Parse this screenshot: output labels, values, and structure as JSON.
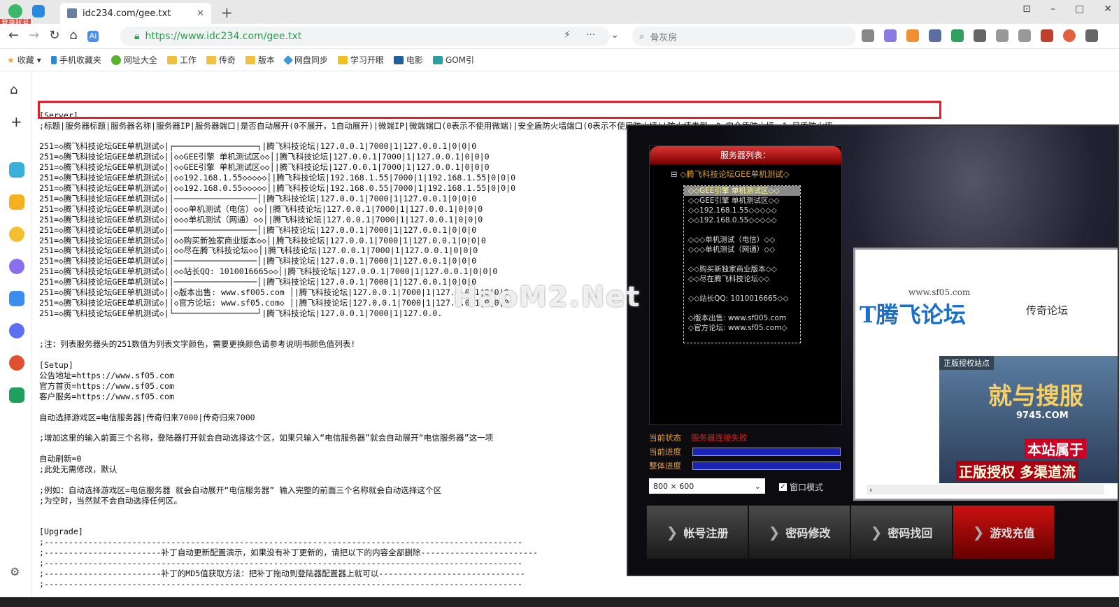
{
  "browser": {
    "tab_title": "idc234.com/gee.txt",
    "badge": "登录账号",
    "url": "https://www.idc234.com/gee.txt",
    "search_placeholder": "骨灰房",
    "bookmarks": [
      "收藏",
      "手机收藏夹",
      "网址大全",
      "工作",
      "传奇",
      "版本",
      "网盘同步",
      "学习开眼",
      "电影",
      "GOM引"
    ]
  },
  "file": {
    "lines": [
      "[Server]",
      ";标题|服务器标题|服务器名称|服务器IP|服务器端口|是否自动展开(0不展开，1自动展开)|微端IP|微端端口(0表示不使用微端)|安全盾防火墙端口(0表示不使用防火墙)|防火墙类型，0=安全盾防火墙，1=风盾防火墙",
      "",
      "251=◇腾飞科技论坛GEE单机测试◇|┌─────────────────┐|腾飞科技论坛|127.0.0.1|7000|1|127.0.0.1|0|0|0",
      "251=◇腾飞科技论坛GEE单机测试◇|│◇◇GEE引擎 单机测试区◇◇│|腾飞科技论坛|127.0.0.1|7000|1|127.0.0.1|0|0|0",
      "251=◇腾飞科技论坛GEE单机测试◇|│◇◇GEE引擎 单机测试区◇◇│|腾飞科技论坛|127.0.0.1|7000|1|127.0.0.1|0|0|0",
      "251=◇腾飞科技论坛GEE单机测试◇|│◇◇192.168.1.55◇◇◇◇◇│|腾飞科技论坛|192.168.1.55|7000|1|192.168.1.55|0|0|0",
      "251=◇腾飞科技论坛GEE单机测试◇|│◇◇192.168.0.55◇◇◇◇◇│|腾飞科技论坛|192.168.0.55|7000|1|192.168.1.55|0|0|0",
      "251=◇腾飞科技论坛GEE单机测试◇|│─────────────────│|腾飞科技论坛|127.0.0.1|7000|1|127.0.0.1|0|0|0",
      "251=◇腾飞科技论坛GEE单机测试◇|│◇◇◇单机测试（电信）◇◇│|腾飞科技论坛|127.0.0.1|7000|1|127.0.0.1|0|0|0",
      "251=◇腾飞科技论坛GEE单机测试◇|│◇◇◇单机测试（网通）◇◇│|腾飞科技论坛|127.0.0.1|7000|1|127.0.0.1|0|0|0",
      "251=◇腾飞科技论坛GEE单机测试◇|│─────────────────│|腾飞科技论坛|127.0.0.1|7000|1|127.0.0.1|0|0|0",
      "251=◇腾飞科技论坛GEE单机测试◇|│◇◇购买新独家商业版本◇◇│|腾飞科技论坛|127.0.0.1|7000|1|127.0.0.1|0|0|0",
      "251=◇腾飞科技论坛GEE单机测试◇|│◇◇尽在腾飞科技论坛◇◇│|腾飞科技论坛|127.0.0.1|7000|1|127.0.0.1|0|0|0",
      "251=◇腾飞科技论坛GEE单机测试◇|│─────────────────│|腾飞科技论坛|127.0.0.1|7000|1|127.0.0.1|0|0|0",
      "251=◇腾飞科技论坛GEE单机测试◇|│◇◇站长QQ: 1010016665◇◇│|腾飞科技论坛|127.0.0.1|7000|1|127.0.0.1|0|0|0",
      "251=◇腾飞科技论坛GEE单机测试◇|│─────────────────│|腾飞科技论坛|127.0.0.1|7000|1|127.0.0.1|0|0|0",
      "251=◇腾飞科技论坛GEE单机测试◇|│◇版本出售: www.sf005.com │|腾飞科技论坛|127.0.0.1|7000|1|127.0.0.1|0|0|0",
      "251=◇腾飞科技论坛GEE单机测试◇|│◇官方论坛: www.sf05.com◇ │|腾飞科技论坛|127.0.0.1|7000|1|127.0.0.1|0|0|0",
      "251=◇腾飞科技论坛GEE单机测试◇|└─────────────────┘|腾飞科技论坛|127.0.0.1|7000|1|127.0.0.",
      "",
      "",
      ";注：列表服务器头的251数值为列表文字颜色，需要更换颜色请参考说明书颜色值列表!",
      "",
      "[Setup]",
      "公告地址=https://www.sf05.com",
      "官方首页=https://www.sf05.com",
      "客户服务=https://www.sf05.com",
      "",
      "自动选择游戏区=电信服务器|传奇归来7000|传奇归来7000",
      "",
      ";增加这里的输入前面三个名称，登陆器打开就会自动选择这个区，如果只输入“电信服务器”就会自动展开“电信服务器”这一项",
      "",
      "自动刷新=0",
      ";此处无需修改，默认",
      "",
      ";例如：自动选择游戏区=电信服务器 就会自动展开“电信服务器” 输入完整的前面三个名称就会自动选择这个区",
      ";为空时，当然就不会自动选择任何区。",
      "",
      "",
      "[Upgrade]",
      ";--------------------------------------------------------------------------------------------------",
      ";------------------------补丁自动更新配置演示，如果没有补丁更新的，请把以下的内容全部删除------------------------",
      ";--------------------------------------------------------------------------------------------------",
      ";------------------------补丁的MD5值获取方法：把补丁拖动到登陆器配置器上就可以------------------------------",
      ";--------------------------------------------------------------------------------------------------"
    ]
  },
  "game": {
    "list_title": "服务器列表：",
    "group": "◇腾飞科技论坛GEE单机测试◇",
    "items": [
      "◇◇GEE引擎 单机测试区◇◇",
      "◇◇GEE引擎 单机测试区◇◇",
      "◇◇192.168.1.55◇◇◇◇◇",
      "◇◇192.168.0.55◇◇◇◇◇",
      "",
      "◇◇◇单机测试（电信）◇◇",
      "◇◇◇单机测试（网通）◇◇",
      "",
      "◇◇购买新独家商业版本◇◇",
      "◇◇尽在腾飞科技论坛◇◇",
      "",
      "◇◇站长QQ: 1010016665◇◇",
      "",
      "◇版本出售: www.sf005.com",
      "◇官方论坛: www.sf05.com◇"
    ],
    "status_label": "当前状态",
    "status_value": "服务器连接失败",
    "progress_label": "当前进度",
    "total_label": "整体进度",
    "resolution": "800 × 600",
    "window_mode": "窗口模式",
    "buttons": [
      "帐号注册",
      "密码修改",
      "密码找回",
      "游戏充值"
    ],
    "web_logo": "腾飞论坛",
    "web_domain": "www.sf05.com",
    "web_nav": "传奇论坛",
    "banner_caption": "正版授权站点",
    "banner_big": "就与搜服",
    "banner_domain": "9745.COM",
    "banner_s1": "本站属于",
    "banner_s2": "正版授权 多渠道流",
    "watermark": "HaoM2.Net"
  }
}
